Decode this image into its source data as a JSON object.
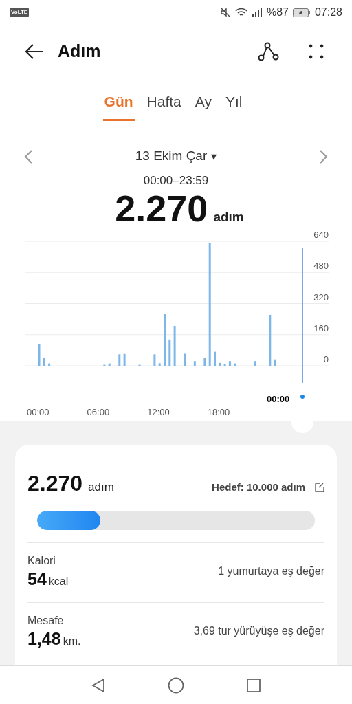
{
  "status_bar": {
    "network_badge": "VoLTE",
    "battery": "%87",
    "time": "07:28"
  },
  "header": {
    "title": "Adım"
  },
  "tabs": [
    {
      "label": "Gün",
      "selected": true
    },
    {
      "label": "Hafta",
      "selected": false
    },
    {
      "label": "Ay",
      "selected": false
    },
    {
      "label": "Yıl",
      "selected": false
    }
  ],
  "date_nav": {
    "date": "13 Ekim Çar",
    "caret": "▾",
    "range": "00:00–23:59"
  },
  "total": {
    "value": "2.270",
    "unit": "adım"
  },
  "chart": {
    "cursor_label": "00:00",
    "chart_data": {
      "type": "bar",
      "x": [
        0,
        0.5,
        1,
        6.5,
        7,
        8,
        8.5,
        10,
        11.5,
        12,
        12.5,
        13,
        13.5,
        14.5,
        15.5,
        16.5,
        17,
        17.5,
        18,
        18.5,
        19,
        19.5,
        21.5,
        23,
        23.5
      ],
      "values": [
        110,
        40,
        12,
        5,
        12,
        59,
        61,
        5,
        59,
        13,
        268,
        135,
        205,
        62,
        24,
        42,
        631,
        72,
        15,
        8,
        24,
        12,
        24,
        262,
        33
      ],
      "xlim": [
        0,
        24
      ],
      "ylim": [
        0,
        640
      ],
      "xticks": [
        {
          "value": 0,
          "label": "00:00"
        },
        {
          "value": 6,
          "label": "06:00"
        },
        {
          "value": 12,
          "label": "12:00"
        },
        {
          "value": 18,
          "label": "18:00"
        }
      ],
      "yticks": [
        0,
        160,
        320,
        480,
        640
      ],
      "grid": true
    }
  },
  "summary": {
    "steps": "2.270",
    "steps_unit": "adım",
    "goal": "Hedef: 10.000 adım",
    "level": 0.227,
    "rows": [
      {
        "label": "Kalori",
        "value": "54",
        "unit": "kcal",
        "equivalent": "1 yumurtaya eş değer"
      },
      {
        "label": "Mesafe",
        "value": "1,48",
        "unit": "km.",
        "equivalent": "3,69 tur yürüyüşe eş değer"
      }
    ]
  }
}
